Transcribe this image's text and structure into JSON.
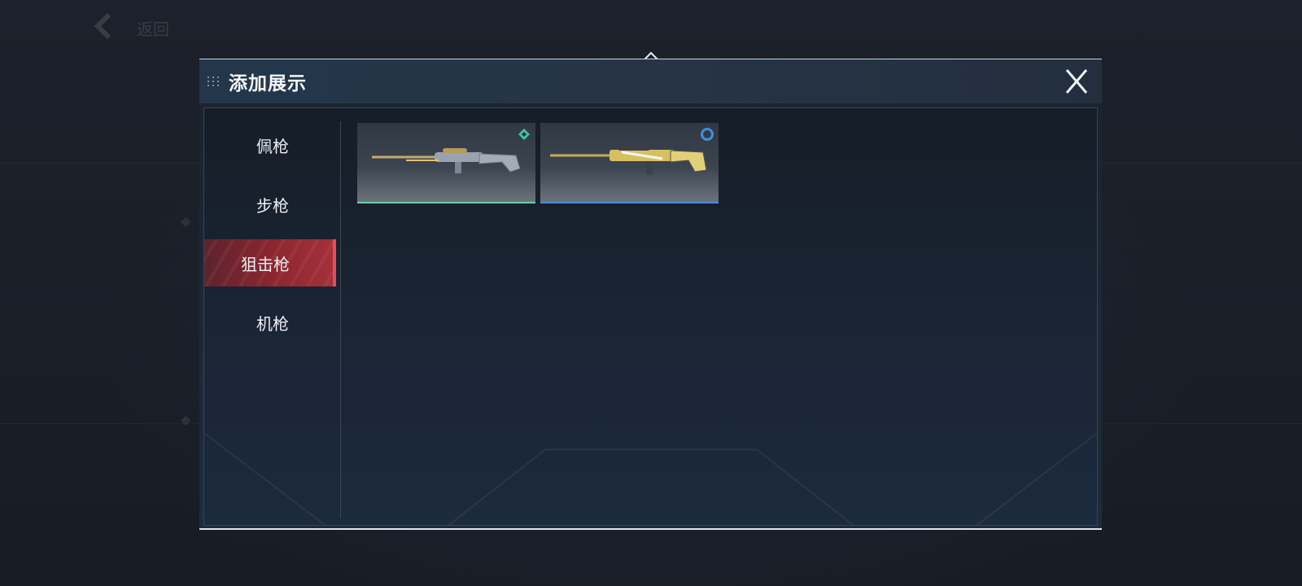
{
  "background": {
    "back_label": "返回"
  },
  "dialog": {
    "title": "添加展示",
    "close_label": "X"
  },
  "categories": [
    {
      "label": "佩枪",
      "active": false
    },
    {
      "label": "步枪",
      "active": false
    },
    {
      "label": "狙击枪",
      "active": true
    },
    {
      "label": "机枪",
      "active": false
    }
  ],
  "items": [
    {
      "name": "sniper-rifle-skin-1",
      "rarity_icon": "diamond-rarity-icon",
      "rarity_color": "#3fc6a0"
    },
    {
      "name": "sniper-rifle-skin-2",
      "rarity_icon": "circle-rarity-icon",
      "rarity_color": "#3f8fe0"
    }
  ],
  "colors": {
    "accent_red": "#a4303a",
    "active_edge": "#e0505c",
    "dialog_title_bar": "#263446"
  }
}
